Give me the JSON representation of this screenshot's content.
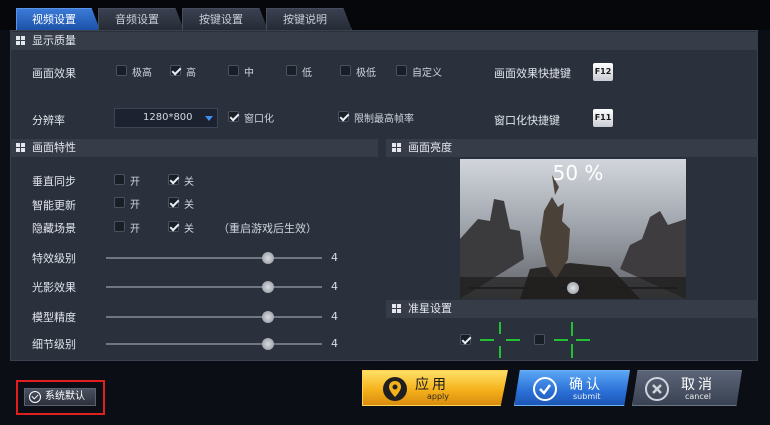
{
  "tabs": [
    "视频设置",
    "音频设置",
    "按键设置",
    "按键说明"
  ],
  "display_quality": {
    "header": "显示质量",
    "effect_label": "画面效果",
    "effect_options": [
      {
        "label": "极高",
        "checked": false
      },
      {
        "label": "高",
        "checked": true
      },
      {
        "label": "中",
        "checked": false
      },
      {
        "label": "低",
        "checked": false
      },
      {
        "label": "极低",
        "checked": false
      },
      {
        "label": "自定义",
        "checked": false
      }
    ],
    "effect_shortcut_label": "画面效果快捷键",
    "effect_shortcut_key": "F12",
    "resolution_label": "分辨率",
    "resolution_value": "1280*800",
    "windowed": {
      "label": "窗口化",
      "checked": true
    },
    "limit_fps": {
      "label": "限制最高帧率",
      "checked": true
    },
    "windowed_shortcut_label": "窗口化快捷键",
    "windowed_shortcut_key": "F11"
  },
  "features": {
    "header": "画面特性",
    "rows": [
      {
        "label": "垂直同步",
        "on": "开",
        "off": "关",
        "on_checked": false,
        "off_checked": true
      },
      {
        "label": "智能更新",
        "on": "开",
        "off": "关",
        "on_checked": false,
        "off_checked": true
      },
      {
        "label": "隐藏场景",
        "on": "开",
        "off": "关",
        "on_checked": false,
        "off_checked": true
      }
    ],
    "restart_note": "（重启游戏后生效）",
    "sliders": [
      {
        "label": "特效级别",
        "value": "4",
        "fraction": 0.75
      },
      {
        "label": "光影效果",
        "value": "4",
        "fraction": 0.75
      },
      {
        "label": "模型精度",
        "value": "4",
        "fraction": 0.75
      },
      {
        "label": "细节级别",
        "value": "4",
        "fraction": 0.75
      }
    ]
  },
  "brightness": {
    "header": "画面亮度",
    "value": "50 %",
    "fraction": 0.5
  },
  "crosshair": {
    "header": "准星设置",
    "options": [
      {
        "checked": true
      },
      {
        "checked": false
      }
    ],
    "color": "#22c032"
  },
  "buttons": {
    "apply": "应用",
    "apply_sub": "apply",
    "ok": "确认",
    "ok_sub": "submit",
    "cancel": "取消",
    "cancel_sub": "cancel",
    "default": "系统默认"
  },
  "colors": {
    "accent": "#2a6fd6",
    "apply": "#f5b21b",
    "highlight": "#e01f1f"
  }
}
